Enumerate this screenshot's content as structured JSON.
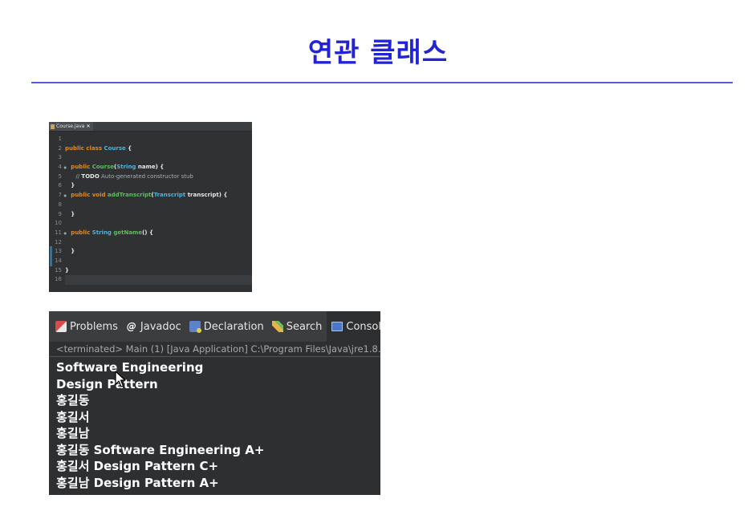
{
  "slide": {
    "title": "연관 클래스"
  },
  "editor": {
    "tab_label": "Course.java",
    "line_numbers": [
      "1",
      "2",
      "3",
      "4",
      "5",
      "6",
      "7",
      "8",
      "9",
      "10",
      "11",
      "12",
      "13",
      "14",
      "15",
      "16"
    ],
    "lines": [
      {
        "segments": []
      },
      {
        "segments": [
          {
            "t": "public class ",
            "c": "kw"
          },
          {
            "t": "Course",
            "c": "ty"
          },
          {
            "t": " {",
            "c": "pl"
          }
        ]
      },
      {
        "segments": []
      },
      {
        "segments": [
          {
            "t": "   public ",
            "c": "kw"
          },
          {
            "t": "Course",
            "c": "fn"
          },
          {
            "t": "(",
            "c": "pl"
          },
          {
            "t": "String",
            "c": "ty"
          },
          {
            "t": " name) {",
            "c": "pl"
          }
        ]
      },
      {
        "segments": [
          {
            "t": "      // ",
            "c": "cm"
          },
          {
            "t": "TODO",
            "c": "cmb"
          },
          {
            "t": " Auto-generated constructor stub",
            "c": "cm"
          }
        ]
      },
      {
        "segments": [
          {
            "t": "   }",
            "c": "pl"
          }
        ]
      },
      {
        "segments": [
          {
            "t": "   public void ",
            "c": "kw"
          },
          {
            "t": "addTranscript",
            "c": "fn"
          },
          {
            "t": "(",
            "c": "pl"
          },
          {
            "t": "Transcript",
            "c": "ty"
          },
          {
            "t": " transcript) {",
            "c": "pl"
          }
        ]
      },
      {
        "segments": []
      },
      {
        "segments": [
          {
            "t": "   }",
            "c": "pl"
          }
        ]
      },
      {
        "segments": []
      },
      {
        "segments": [
          {
            "t": "   public ",
            "c": "kw"
          },
          {
            "t": "String",
            "c": "ty"
          },
          {
            "t": " ",
            "c": "pl"
          },
          {
            "t": "getName",
            "c": "fn"
          },
          {
            "t": "() {",
            "c": "pl"
          }
        ]
      },
      {
        "segments": []
      },
      {
        "segments": [
          {
            "t": "   }",
            "c": "pl"
          }
        ]
      },
      {
        "segments": []
      },
      {
        "segments": [
          {
            "t": "}",
            "c": "pl"
          }
        ]
      },
      {
        "segments": []
      }
    ]
  },
  "console": {
    "tabs": [
      {
        "label": "Problems",
        "icon": "problems-icon"
      },
      {
        "label": "Javadoc",
        "icon": "javadoc-icon"
      },
      {
        "label": "Declaration",
        "icon": "declaration-icon"
      },
      {
        "label": "Search",
        "icon": "search-icon"
      },
      {
        "label": "Console",
        "icon": "console-icon"
      }
    ],
    "close_glyph": "✕",
    "status": "<terminated> Main (1) [Java Application] C:\\Program Files\\Java\\jre1.8.0",
    "output": [
      "Software Engineering",
      "Design Pattern",
      "홍길동",
      "홍길서",
      "홍길남",
      "홍길동 Software Engineering A+",
      "홍길서 Design Pattern C+",
      "홍길남 Design Pattern A+"
    ]
  }
}
